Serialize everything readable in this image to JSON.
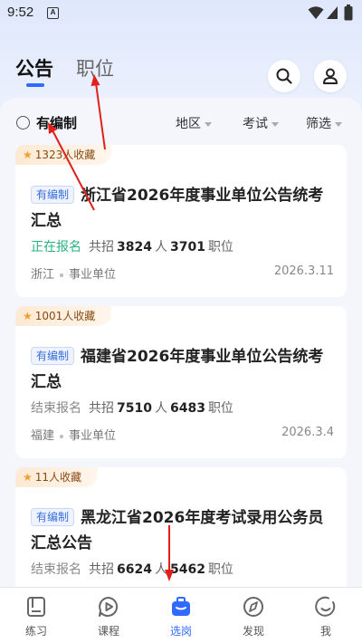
{
  "status_bar": {
    "time": "9:52",
    "notif": "A"
  },
  "header": {
    "tabs": [
      {
        "label": "公告",
        "active": true
      },
      {
        "label": "职位",
        "active": false
      }
    ],
    "search_icon": "search-icon",
    "user_icon": "user-icon"
  },
  "filters": {
    "established_label": "有编制",
    "region": "地区",
    "exam": "考试",
    "filter": "筛选"
  },
  "cards": [
    {
      "favorites": "1323人收藏",
      "badge": "有编制",
      "title": "浙江省2026年度事业单位公告统考汇总",
      "status": "正在报名",
      "recruit_prefix": "共招",
      "people_count": "3824",
      "people_unit": "人",
      "positions_count": "3701",
      "positions_unit": "职位",
      "province": "浙江",
      "category": "事业单位",
      "date": "2026.3.11"
    },
    {
      "favorites": "1001人收藏",
      "badge": "有编制",
      "title": "福建省2026年度事业单位公告统考汇总",
      "status": "结束报名",
      "recruit_prefix": "共招",
      "people_count": "7510",
      "people_unit": "人",
      "positions_count": "6483",
      "positions_unit": "职位",
      "province": "福建",
      "category": "事业单位",
      "date": "2026.3.4"
    },
    {
      "favorites": "11人收藏",
      "badge": "有编制",
      "title": "黑龙江省2026年度考试录用公务员汇总公告",
      "status": "结束报名",
      "recruit_prefix": "共招",
      "people_count": "6624",
      "people_unit": "人",
      "positions_count": "5462",
      "positions_unit": "职位"
    }
  ],
  "bottom_nav": [
    {
      "label": "练习",
      "icon": "book-icon",
      "active": false
    },
    {
      "label": "课程",
      "icon": "play-icon",
      "active": false
    },
    {
      "label": "选岗",
      "icon": "briefcase-icon",
      "active": true
    },
    {
      "label": "发现",
      "icon": "compass-icon",
      "active": false
    },
    {
      "label": "我",
      "icon": "smile-icon",
      "active": false
    }
  ],
  "colors": {
    "accent": "#2f6bff",
    "active_status": "#27b37d",
    "annotation_arrow": "#e0201b"
  }
}
